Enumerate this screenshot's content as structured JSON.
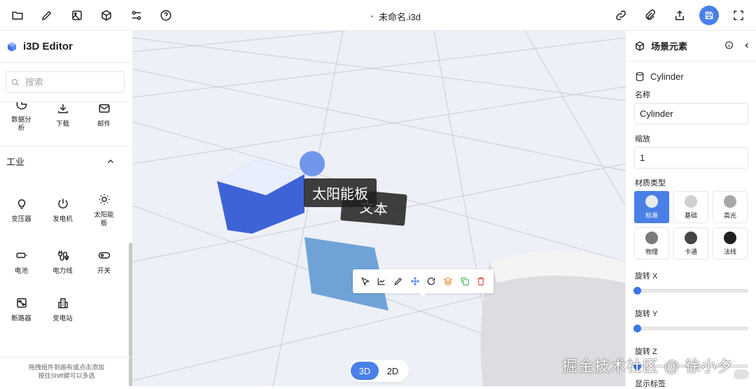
{
  "topbar": {
    "file_title": "未命名.i3d",
    "left_icons": [
      "folder-icon",
      "pencil-icon",
      "image-icon",
      "cube-icon",
      "sliders-icon",
      "help-icon"
    ],
    "right_icons": [
      "link-icon",
      "paperclip-icon",
      "share-icon",
      "save-icon",
      "fullscreen-icon"
    ]
  },
  "sidebar": {
    "app_name": "i3D Editor",
    "search_placeholder": "搜索",
    "top_items": [
      {
        "label": "数据分析",
        "icon": "chart-pie-icon"
      },
      {
        "label": "下载",
        "icon": "download-icon"
      },
      {
        "label": "邮件",
        "icon": "mail-icon"
      }
    ],
    "section": {
      "title": "工业",
      "items": [
        {
          "label": "变压器",
          "icon": "bulb-icon"
        },
        {
          "label": "发电机",
          "icon": "power-icon"
        },
        {
          "label": "太阳能板",
          "icon": "sun-icon"
        },
        {
          "label": "电池",
          "icon": "battery-icon"
        },
        {
          "label": "电力线",
          "icon": "plug-icon"
        },
        {
          "label": "开关",
          "icon": "toggle-icon"
        },
        {
          "label": "断路器",
          "icon": "breaker-icon"
        },
        {
          "label": "变电站",
          "icon": "building-icon"
        }
      ]
    },
    "footer": [
      "拖拽组件到画布或点击添加",
      "按住Shift键可以多选"
    ]
  },
  "viewport": {
    "labels": [
      "太阳能板",
      "文本"
    ],
    "mode_options": [
      "3D",
      "2D"
    ],
    "active_mode": "3D",
    "watermark": "掘金技术社区 @ 徐小夕",
    "toolbar": [
      "select-icon",
      "chart-line-icon",
      "edit-icon",
      "move-icon",
      "rotate-icon",
      "layers-icon",
      "copy-icon",
      "delete-icon"
    ]
  },
  "panel": {
    "title": "场景元素",
    "object_name": "Cylinder",
    "name_label": "名称",
    "name_value": "Cylinder",
    "scale_label": "缩放",
    "scale_value": "1",
    "material_label": "材质类型",
    "materials": [
      {
        "label": "标准",
        "color": "#e8ebf0"
      },
      {
        "label": "基础",
        "color": "#d0d0d0"
      },
      {
        "label": "高光",
        "color": "#a8a8a8"
      },
      {
        "label": "物理",
        "color": "#7a7a7a"
      },
      {
        "label": "卡通",
        "color": "#454545"
      },
      {
        "label": "法线",
        "color": "#202020"
      }
    ],
    "selected_material": "标准",
    "rotations": [
      {
        "label": "旋转 X",
        "value": 0
      },
      {
        "label": "旋转 Y",
        "value": 0
      },
      {
        "label": "旋转 Z",
        "value": 0
      }
    ],
    "show_labels": "显示标签"
  },
  "colors": {
    "accent": "#4a7fe8"
  }
}
